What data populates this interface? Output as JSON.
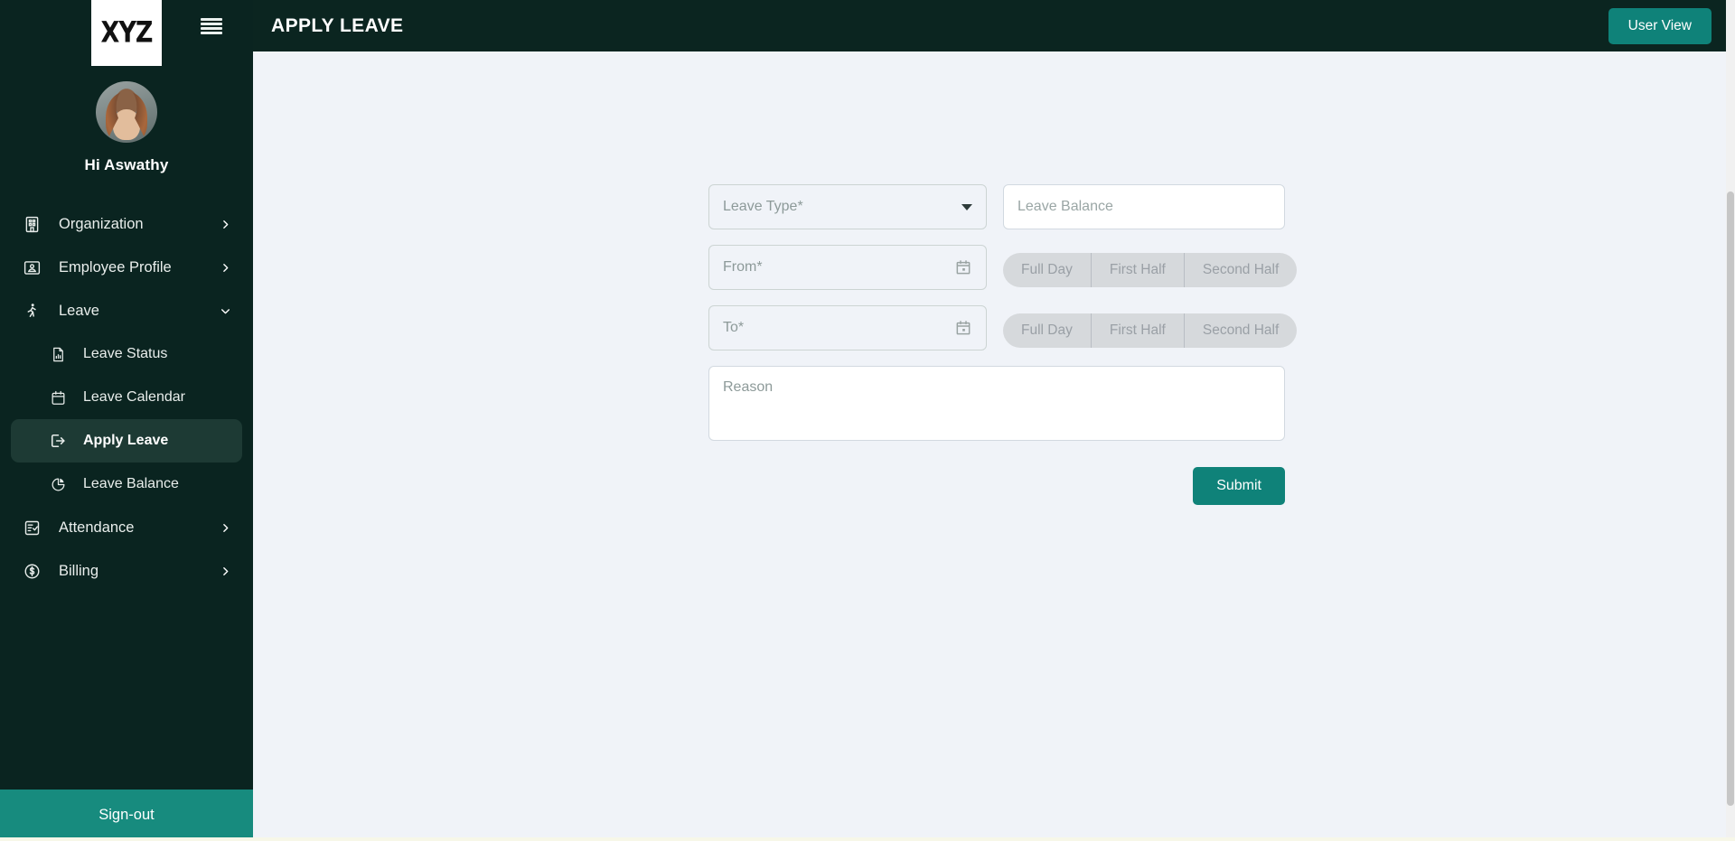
{
  "brand": {
    "logo_text": "XYZ"
  },
  "sidebar": {
    "greeting": "Hi Aswathy",
    "items": [
      {
        "label": "Organization",
        "icon": "building-icon",
        "chevron": "chevron-right-icon"
      },
      {
        "label": "Employee Profile",
        "icon": "id-badge-icon",
        "chevron": "chevron-right-icon"
      },
      {
        "label": "Leave",
        "icon": "walking-person-icon",
        "chevron": "chevron-down-icon"
      }
    ],
    "sub_items": [
      {
        "label": "Leave Status",
        "icon": "document-chart-icon"
      },
      {
        "label": "Leave Calendar",
        "icon": "calendar-icon"
      },
      {
        "label": "Apply Leave",
        "icon": "logout-arrow-icon",
        "active": true
      },
      {
        "label": "Leave Balance",
        "icon": "pie-chart-icon"
      }
    ],
    "items_bottom": [
      {
        "label": "Attendance",
        "icon": "clipboard-check-icon",
        "chevron": "chevron-right-icon"
      },
      {
        "label": "Billing",
        "icon": "dollar-circle-icon",
        "chevron": "chevron-right-icon"
      }
    ],
    "signout_label": "Sign-out"
  },
  "header": {
    "title": "APPLY LEAVE",
    "user_view_label": "User View",
    "menu_icon": "hamburger-icon"
  },
  "form": {
    "leave_type": {
      "placeholder": "Leave Type*",
      "value": ""
    },
    "leave_balance": {
      "placeholder": "Leave Balance",
      "value": ""
    },
    "from_date": {
      "placeholder": "From*",
      "value": "",
      "icon": "calendar-icon"
    },
    "to_date": {
      "placeholder": "To*",
      "value": "",
      "icon": "calendar-icon"
    },
    "from_duration": {
      "options": [
        "Full Day",
        "First Half",
        "Second Half"
      ],
      "selected": ""
    },
    "to_duration": {
      "options": [
        "Full Day",
        "First Half",
        "Second Half"
      ],
      "selected": ""
    },
    "reason": {
      "placeholder": "Reason",
      "value": ""
    },
    "submit_label": "Submit"
  },
  "colors": {
    "sidebar_bg": "#0a2420",
    "topbar_bg": "#0b2520",
    "accent_teal": "#0f8279",
    "signout_teal": "#178b7e",
    "content_bg": "#f0f3f8",
    "active_item_bg": "#1d3a34"
  }
}
